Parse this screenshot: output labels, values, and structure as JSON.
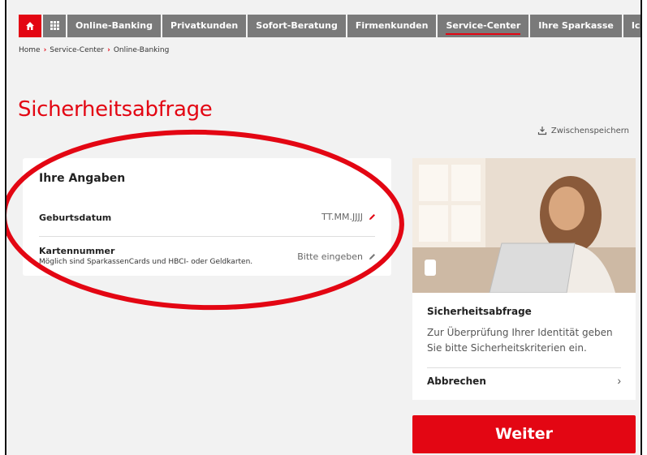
{
  "nav": {
    "items": [
      {
        "label": "Online-Banking"
      },
      {
        "label": "Privatkunden"
      },
      {
        "label": "Sofort-Beratung"
      },
      {
        "label": "Firmenkunden"
      },
      {
        "label": "Service-Center",
        "active": true
      },
      {
        "label": "Ihre Sparkasse"
      },
      {
        "label": "Ich möchte ..."
      }
    ],
    "home_icon": "home-icon",
    "grid_icon": "grid-icon"
  },
  "breadcrumb": [
    "Home",
    "Service-Center",
    "Online-Banking"
  ],
  "page": {
    "title": "Sicherheitsabfrage",
    "save_label": "Zwischenspeichern"
  },
  "form": {
    "heading": "Ihre Angaben",
    "birthdate": {
      "label": "Geburtsdatum",
      "placeholder": "TT.MM.JJJJ"
    },
    "cardnumber": {
      "label": "Kartennummer",
      "placeholder": "Bitte eingeben",
      "hint": "Möglich sind SparkassenCards und HBCI- oder Geldkarten."
    }
  },
  "info": {
    "title": "Sicherheitsabfrage",
    "text": "Zur Überprüfung Ihrer Identität geben Sie bitte Sicherheitskriterien ein.",
    "cancel_label": "Abbrechen"
  },
  "actions": {
    "next_label": "Weiter"
  },
  "colors": {
    "brand": "#e30613",
    "nav_bg": "#7a7a7a",
    "page_bg": "#f2f2f2"
  }
}
